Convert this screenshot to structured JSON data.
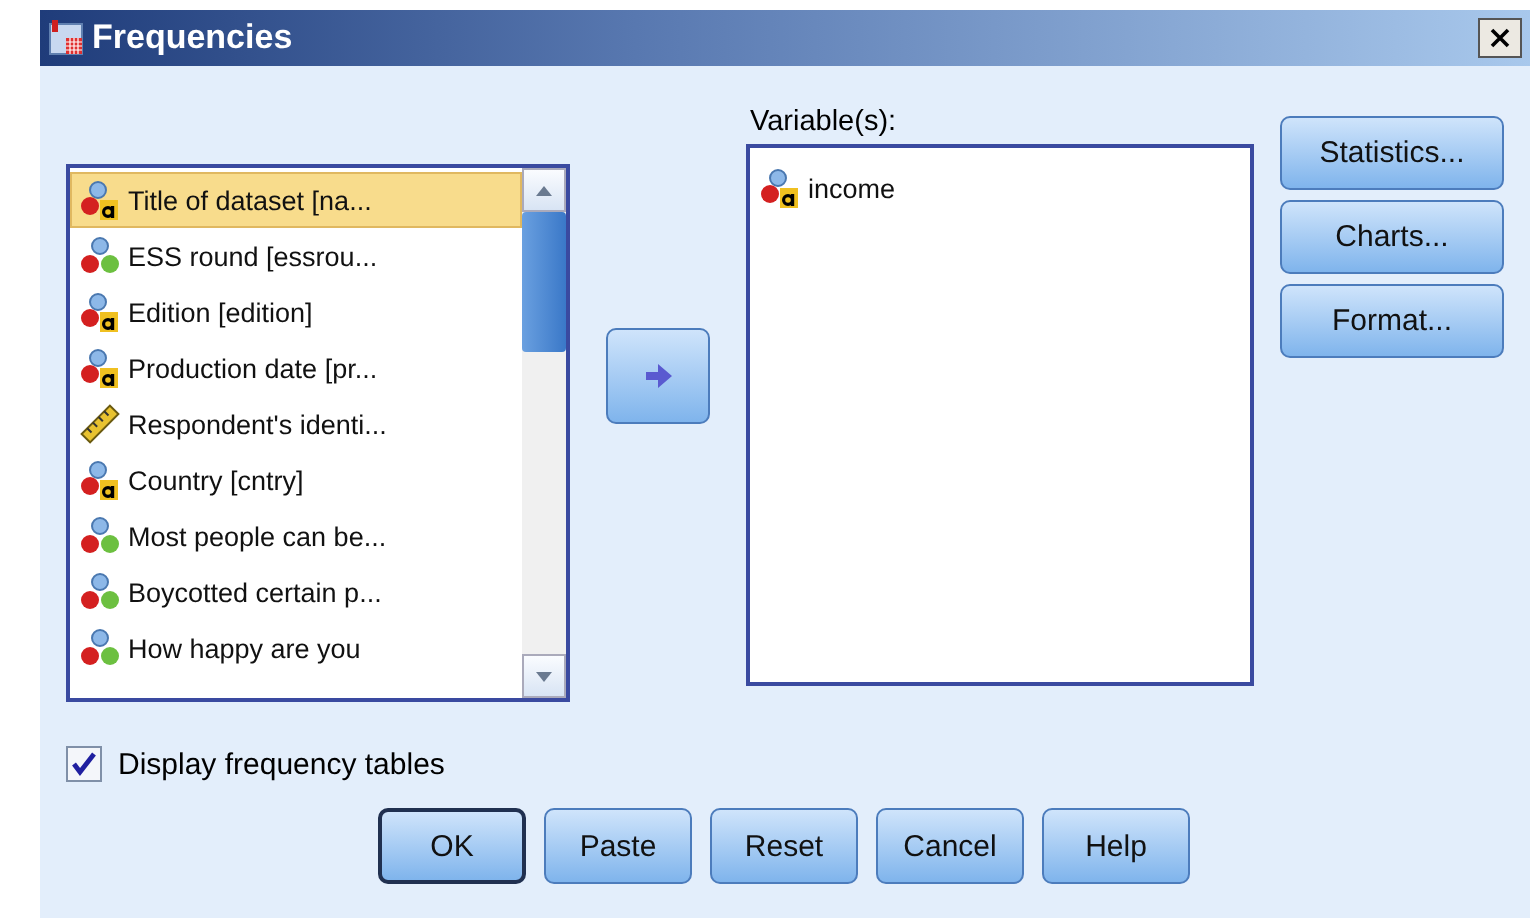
{
  "window": {
    "title": "Frequencies"
  },
  "source_list": {
    "items": [
      {
        "label": "Title of dataset [na...",
        "kind": "string",
        "selected": true
      },
      {
        "label": "ESS round [essrou...",
        "kind": "nominal",
        "selected": false
      },
      {
        "label": "Edition [edition]",
        "kind": "string",
        "selected": false
      },
      {
        "label": "Production date [pr...",
        "kind": "string",
        "selected": false
      },
      {
        "label": "Respondent's identi...",
        "kind": "scale",
        "selected": false
      },
      {
        "label": "Country [cntry]",
        "kind": "string",
        "selected": false
      },
      {
        "label": "Most people can be...",
        "kind": "nominal",
        "selected": false
      },
      {
        "label": "Boycotted certain p...",
        "kind": "nominal",
        "selected": false
      },
      {
        "label": "How happy are you",
        "kind": "nominal",
        "selected": false
      }
    ]
  },
  "target_list": {
    "label": "Variable(s):",
    "items": [
      {
        "label": "income",
        "kind": "string"
      }
    ]
  },
  "side_buttons": [
    "Statistics...",
    "Charts...",
    "Format..."
  ],
  "display_frequency_tables": {
    "label": "Display frequency tables",
    "checked": true
  },
  "buttons": [
    {
      "label": "OK",
      "default": true
    },
    {
      "label": "Paste",
      "default": false
    },
    {
      "label": "Reset",
      "default": false
    },
    {
      "label": "Cancel",
      "default": false
    },
    {
      "label": "Help",
      "default": false
    }
  ]
}
